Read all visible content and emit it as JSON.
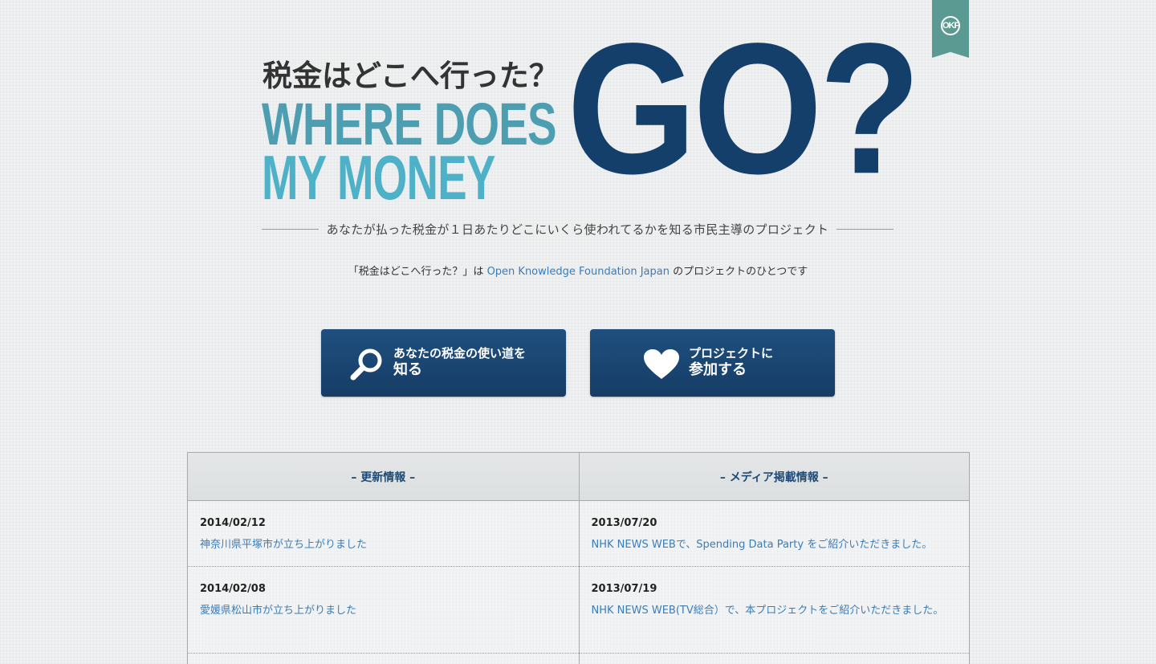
{
  "header": {
    "jp_title": "税金はどこへ行った？",
    "en_line1": "WHERE DOES",
    "en_line2": "MY MONEY",
    "go": "GO?",
    "tagline": "あなたが払った税金が１日あたりどこにいくら使われてるかを知る市民主導のプロジェクト",
    "subline_prefix": "「税金はどこへ行った？」は",
    "subline_link": "Open Knowledge Foundation Japan",
    "subline_suffix": "のプロジェクトのひとつです"
  },
  "ribbon": {
    "logo": "OKF",
    "icon": "okf-logo-icon",
    "color": "#5a9a93"
  },
  "buttons": [
    {
      "icon": "search-icon",
      "line1": "あなたの税金の使い道を",
      "line2": "知る"
    },
    {
      "icon": "heart-icon",
      "line1": "プロジェクトに",
      "line2": "参加する"
    }
  ],
  "news": {
    "updates": {
      "title": "– 更新情報 –",
      "items": [
        {
          "date": "2014/02/12",
          "text": "神奈川県平塚市が立ち上がりました"
        },
        {
          "date": "2014/02/08",
          "text": "愛媛県松山市が立ち上がりました"
        }
      ]
    },
    "media": {
      "title": "– メディア掲載情報 –",
      "items": [
        {
          "date": "2013/07/20",
          "text": "NHK NEWS WEBで、Spending Data Party をご紹介いただきました。"
        },
        {
          "date": "2013/07/19",
          "text": "NHK NEWS WEB(TV総合）で、本プロジェクトをご紹介いただきました。"
        }
      ]
    }
  },
  "colors": {
    "accent_dark": "#143f6b",
    "accent_light": "#4fb1c8",
    "link": "#3c7cb5"
  }
}
